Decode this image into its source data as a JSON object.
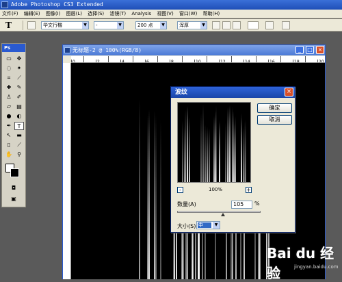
{
  "app": {
    "title": "Adobe Photoshop CS3 Extended"
  },
  "menu": [
    "文件(F)",
    "编辑(E)",
    "图像(I)",
    "图层(L)",
    "选择(S)",
    "滤镜(T)",
    "Analysis",
    "视图(V)",
    "窗口(W)",
    "帮助(H)"
  ],
  "options": {
    "tool_glyph": "T",
    "font_family": "华文行楷",
    "font_style": "-",
    "size": "200 点",
    "aa": "浑厚"
  },
  "toolbox": {
    "header": "Ps"
  },
  "document": {
    "title": "无标题-2 @ 100%(RGB/8)",
    "ruler_ticks": [
      "0",
      "",
      "2",
      "",
      "4",
      "",
      "6",
      "",
      "8",
      "",
      "10",
      "",
      "12",
      "",
      "14",
      "",
      "16",
      "",
      "18",
      "",
      "20"
    ]
  },
  "dialog": {
    "title": "波纹",
    "ok_label": "确定",
    "cancel_label": "取消",
    "zoom_minus": "-",
    "zoom_plus": "+",
    "zoom_level": "100%",
    "amount_label": "数量(A)",
    "amount_value": "105",
    "amount_unit": "%",
    "amount_fraction": 0.55,
    "size_label": "大小(S)",
    "size_value": "中"
  },
  "watermark": {
    "brand": "Bai du 经验",
    "url": "jingyan.baidu.com"
  }
}
